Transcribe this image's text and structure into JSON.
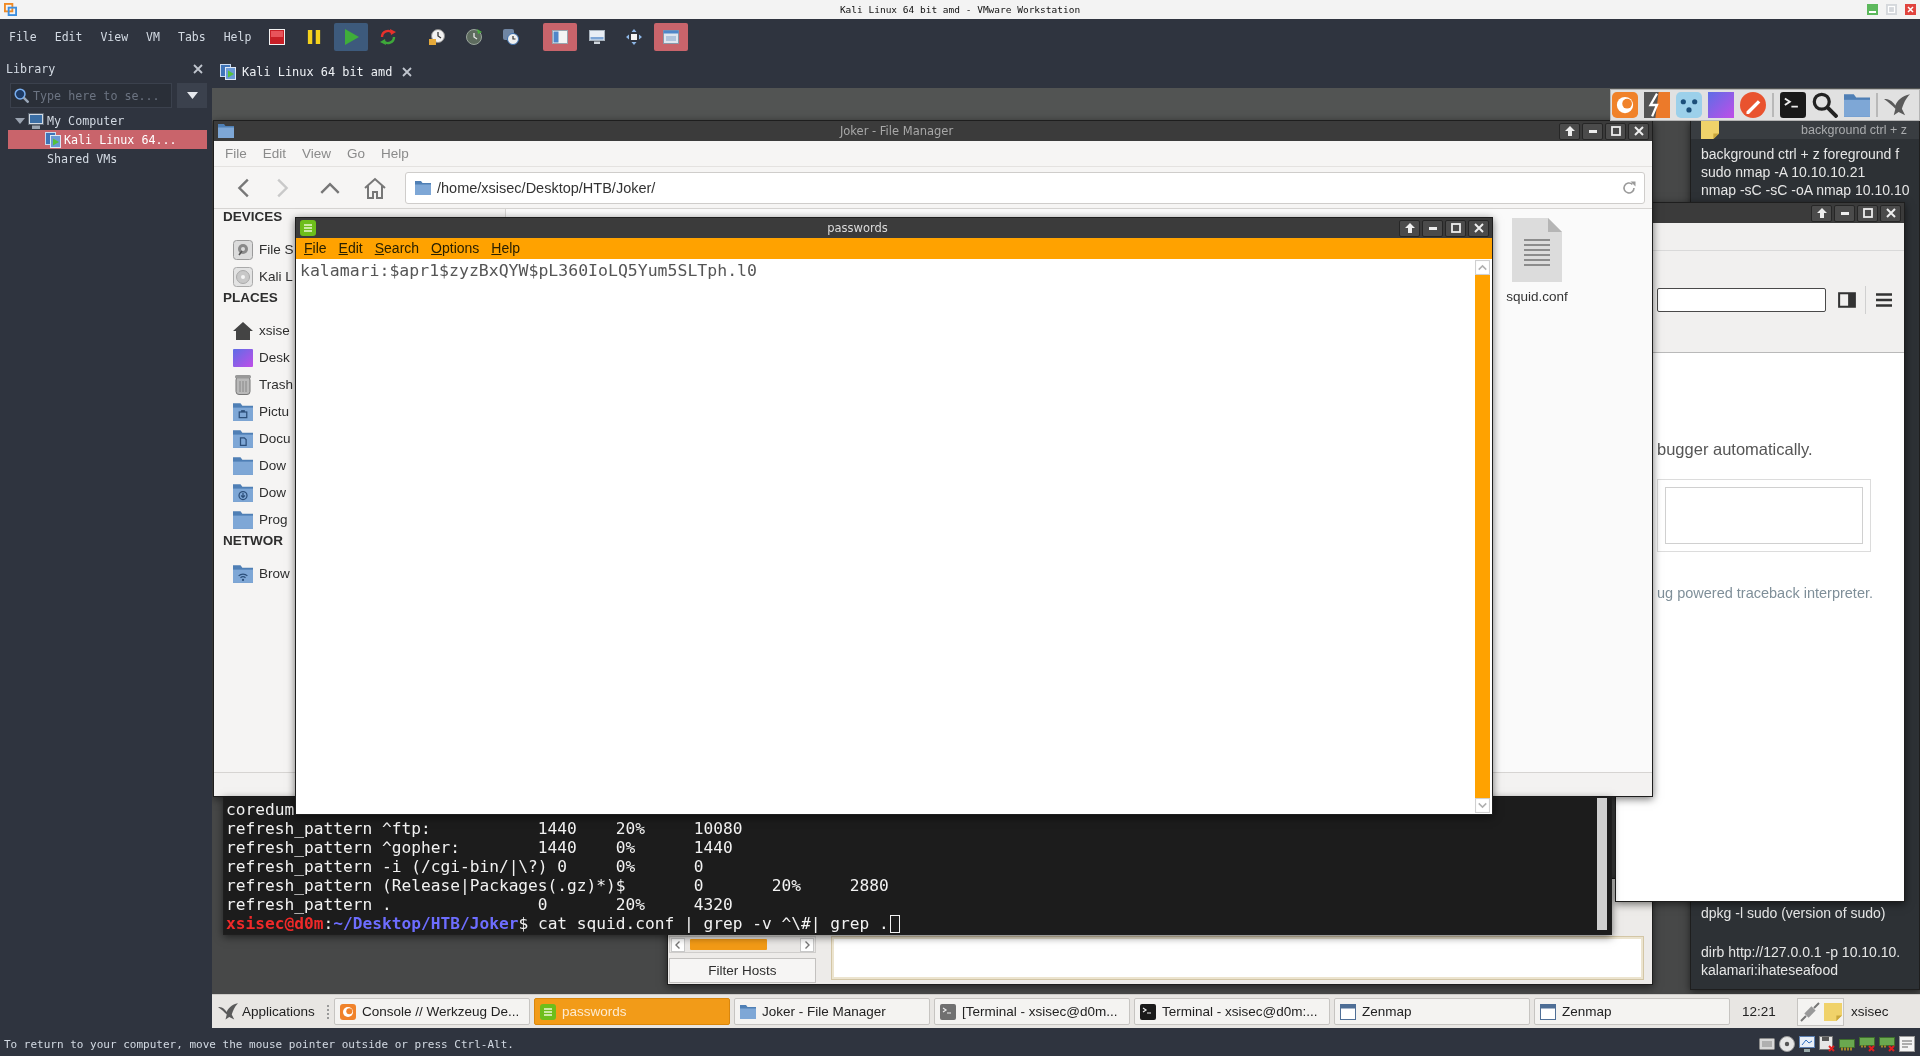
{
  "window": {
    "title": "Kali Linux 64 bit amd - VMware Workstation"
  },
  "menu": [
    "File",
    "Edit",
    "View",
    "VM",
    "Tabs",
    "Help"
  ],
  "toolbar": {
    "groups": [
      [
        {
          "kind": "stop",
          "hovered": false,
          "pressed": false
        },
        {
          "kind": "pause",
          "hovered": false,
          "pressed": false
        },
        {
          "kind": "play",
          "hovered": true,
          "pressed": false
        },
        {
          "kind": "restart",
          "hovered": false,
          "pressed": false
        }
      ],
      [
        {
          "kind": "snapshot",
          "hovered": false,
          "pressed": false
        },
        {
          "kind": "snapshot-revert",
          "hovered": false,
          "pressed": false
        },
        {
          "kind": "snapshot-manager",
          "hovered": false,
          "pressed": false
        }
      ],
      [
        {
          "kind": "library-view",
          "hovered": false,
          "pressed": true
        },
        {
          "kind": "console-view",
          "hovered": false,
          "pressed": false
        },
        {
          "kind": "fit-view",
          "hovered": false,
          "pressed": false
        },
        {
          "kind": "fullscreen",
          "hovered": false,
          "pressed": true
        }
      ]
    ]
  },
  "library": {
    "title": "Library",
    "search": {
      "placeholder": "Type here to se..."
    },
    "tree": [
      {
        "label": "My Computer",
        "kind": "computer",
        "expanded": true,
        "selected": false,
        "children": [
          {
            "label": "Kali Linux 64...",
            "kind": "vm",
            "selected": true
          }
        ]
      },
      {
        "label": "Shared VMs",
        "kind": "shared",
        "selected": false
      }
    ]
  },
  "tabs": [
    {
      "label": "Kali Linux 64 bit amd",
      "selected": true
    }
  ],
  "guest": {
    "notes": {
      "title": "background ctrl + z",
      "lines_above": [
        "background ctrl + z foreground f",
        "sudo nmap -A 10.10.10.21",
        "nmap -sC -sC -oA nmap 10.10.10"
      ],
      "paragraphs_below": [
        [
          "dpkg -l sudo (version of sudo)"
        ],
        [
          "dirb http://127.0.0.1 -p 10.10.10.",
          "kalamari:ihateseafood"
        ]
      ]
    },
    "browser": {
      "message": "bugger automatically.",
      "footer": "ug powered traceback interpreter."
    },
    "file_manager": {
      "title": "Joker - File Manager",
      "menu": [
        "File",
        "Edit",
        "View",
        "Go",
        "Help"
      ],
      "nav": [
        {
          "kind": "back",
          "disabled": false
        },
        {
          "kind": "forward",
          "disabled": true
        },
        {
          "kind": "up",
          "disabled": false
        },
        {
          "kind": "home",
          "disabled": false
        }
      ],
      "location": "/home/xsisec/Desktop/HTB/Joker/",
      "sidebar": [
        {
          "kind": "heading",
          "label": "DEVICES"
        },
        {
          "kind": "drive",
          "label": "File S"
        },
        {
          "kind": "disc",
          "label": "Kali L"
        },
        {
          "kind": "heading",
          "label": "PLACES"
        },
        {
          "kind": "home",
          "label": "xsise"
        },
        {
          "kind": "desktop",
          "label": "Desk"
        },
        {
          "kind": "trash",
          "label": "Trash"
        },
        {
          "kind": "pictures",
          "label": "Pictu"
        },
        {
          "kind": "documents",
          "label": "Docu"
        },
        {
          "kind": "folder",
          "label": "Dow"
        },
        {
          "kind": "downloads",
          "label": "Dow"
        },
        {
          "kind": "folder",
          "label": "Prog"
        },
        {
          "kind": "heading",
          "label": "NETWOR"
        },
        {
          "kind": "network",
          "label": "Brow"
        }
      ],
      "files": [
        {
          "name": "squid.conf",
          "kind": "text"
        }
      ]
    },
    "zenmap": {
      "filter_button": "Filter Hosts"
    },
    "terminal": {
      "lines": [
        "coredum",
        "refresh_pattern ^ftp:           1440    20%     10080",
        "refresh_pattern ^gopher:        1440    0%      1440",
        "refresh_pattern -i (/cgi-bin/|\\?) 0     0%      0",
        "refresh_pattern (Release|Packages(.gz)*)$       0       20%     2880",
        "refresh_pattern .               0       20%     4320"
      ],
      "prompt": [
        {
          "kind": "user",
          "text": "xsisec@d0m"
        },
        {
          "kind": "plain",
          "text": ":"
        },
        {
          "kind": "path",
          "text": "~/Desktop/HTB/Joker"
        },
        {
          "kind": "plain",
          "text": "$ cat squid.conf | grep -v ^\\#| grep ."
        }
      ]
    },
    "editor": {
      "title": "passwords",
      "menu": [
        "File",
        "Edit",
        "Search",
        "Options",
        "Help"
      ],
      "text": "kalamari:$apr1$zyzBxQYW$pL360IoLQ5Yum5SLTph.l0"
    },
    "taskbar": {
      "menu": "Applications",
      "tasks": [
        {
          "label": "Console // Werkzeug De...",
          "kind": "browser",
          "selected": false
        },
        {
          "label": "passwords",
          "kind": "editor",
          "selected": true
        },
        {
          "label": "Joker - File Manager",
          "kind": "folder",
          "selected": false
        },
        {
          "label": "[Terminal - xsisec@d0m...",
          "kind": "terminal-alt",
          "selected": false
        },
        {
          "label": "Terminal - xsisec@d0m:...",
          "kind": "terminal",
          "selected": false
        },
        {
          "label": "Zenmap",
          "kind": "window",
          "selected": false
        },
        {
          "label": "Zenmap",
          "kind": "window",
          "selected": false
        }
      ],
      "clock": "12:21",
      "user": "xsisec"
    }
  },
  "status_bar": {
    "text": "To return to your computer, move the mouse pointer outside or press Ctrl-Alt."
  }
}
